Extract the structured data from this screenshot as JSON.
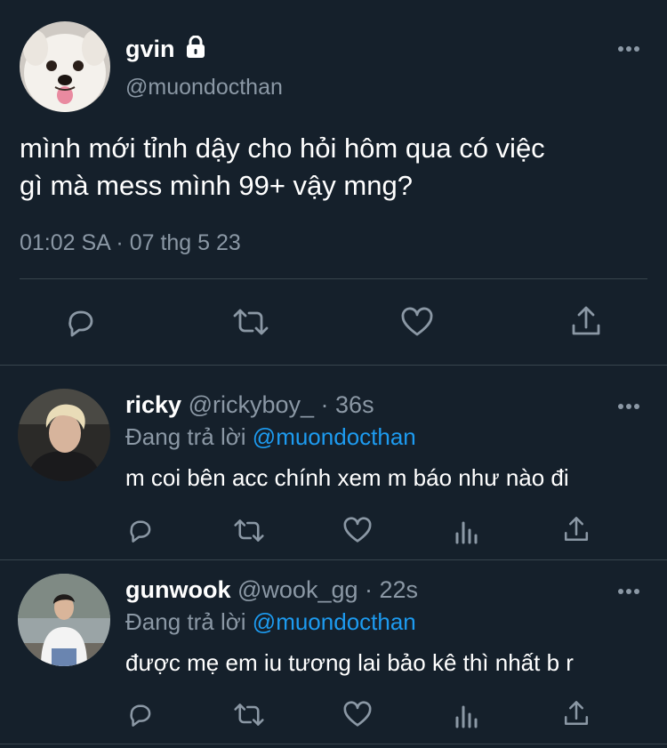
{
  "main_tweet": {
    "display_name": "gvin",
    "handle": "@muondocthan",
    "text_line1": "mình mới tỉnh dậy cho hỏi hôm qua có việc",
    "text_line2": "gì mà mess mình 99+ vậy mng?",
    "timestamp": "01:02 SA · 07 thg 5 23",
    "icons": [
      "more-icon",
      "lock-icon",
      "reply-icon",
      "retweet-icon",
      "like-icon",
      "share-icon"
    ]
  },
  "replies": [
    {
      "display_name": "ricky",
      "handle": "@rickyboy_",
      "time": "· 36s",
      "replying_label": "Đang trả lời",
      "replying_to": "@muondocthan",
      "text": "m coi bên acc chính xem m báo như nào đi"
    },
    {
      "display_name": "gunwook",
      "handle": "@wook_gg",
      "time": "· 22s",
      "replying_label": "Đang trả lời",
      "replying_to": "@muondocthan",
      "text": "được mẹ em iu tương lai bảo kê thì nhất b r"
    }
  ],
  "colors": {
    "background": "#15202b",
    "text": "#ffffff",
    "muted": "#8b98a5",
    "link": "#1d9bf0",
    "divider": "#38444d"
  }
}
